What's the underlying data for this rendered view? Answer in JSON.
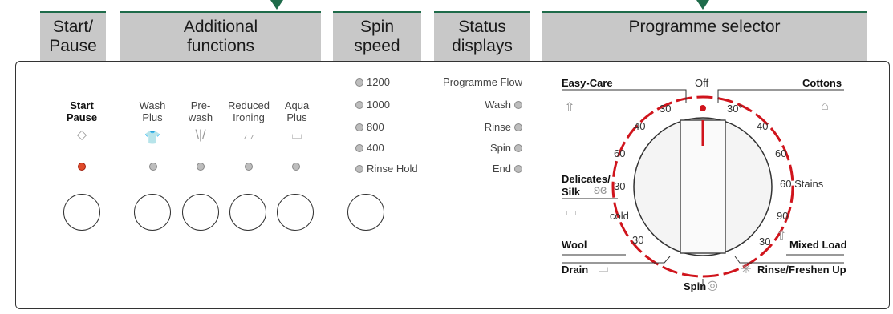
{
  "headers": {
    "start_pause": "Start/\nPause",
    "additional": "Additional\nfunctions",
    "spin_speed": "Spin\nspeed",
    "status": "Status\ndisplays",
    "programme": "Programme selector"
  },
  "start": {
    "label1": "Start",
    "label2": "Pause"
  },
  "functions": [
    {
      "l1": "Wash",
      "l2": "Plus"
    },
    {
      "l1": "Pre-",
      "l2": "wash"
    },
    {
      "l1": "Reduced",
      "l2": "Ironing"
    },
    {
      "l1": "Aqua",
      "l2": "Plus"
    }
  ],
  "speeds": [
    "1200",
    "1000",
    "800",
    "400",
    "Rinse Hold"
  ],
  "status_items": [
    "Programme Flow",
    "Wash",
    "Rinse",
    "Spin",
    "End"
  ],
  "programme": {
    "easy_care": "Easy-Care",
    "off": "Off",
    "cottons": "Cottons",
    "delicates": "Delicates/",
    "silk": "Silk",
    "wool": "Wool",
    "drain": "Drain",
    "spin": "Spin",
    "mixed_load": "Mixed Load",
    "rinse_freshen": "Rinse/Freshen Up",
    "cold": "cold",
    "stains": "60 Stains",
    "temps": {
      "t30a": "30",
      "t30deg": "30°",
      "t40a": "40",
      "t40b": "40",
      "t60a": "60",
      "t60b": "60",
      "t30c": "30",
      "t90": "90",
      "t30d": "30",
      "t30e": "30"
    }
  },
  "colors": {
    "accent": "#1e6b4a",
    "header_bg": "#c8c8c8",
    "dial_red": "#d0141c"
  }
}
